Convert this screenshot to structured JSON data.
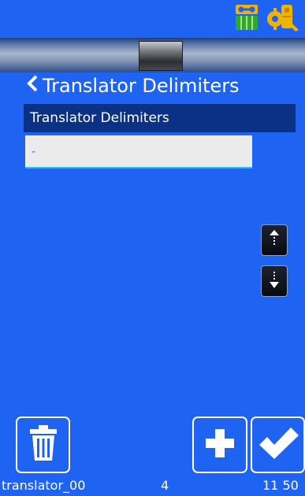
{
  "screen": {
    "title": "Translator Delimiters",
    "back_icon": "chevron-left-icon"
  },
  "status_bar": {
    "icons": [
      "cassette-battery-icon",
      "printhead-wrench-icon"
    ]
  },
  "list": {
    "header": "Translator Delimiters",
    "items": [
      {
        "value": "-"
      }
    ]
  },
  "controls": {
    "move_up_icon": "move-up-icon",
    "move_down_icon": "move-down-icon",
    "delete_icon": "trash-icon",
    "add_icon": "plus-icon",
    "confirm_icon": "check-icon"
  },
  "footer": {
    "name": "translator_00",
    "count": "4",
    "time": "11 50"
  },
  "colors": {
    "background": "#1f63f2",
    "header_bg": "#0b3185",
    "input_bg": "#ebebeb",
    "input_underline": "#25c7df",
    "status_yellow": "#f0b400",
    "status_green": "#2fa830"
  }
}
